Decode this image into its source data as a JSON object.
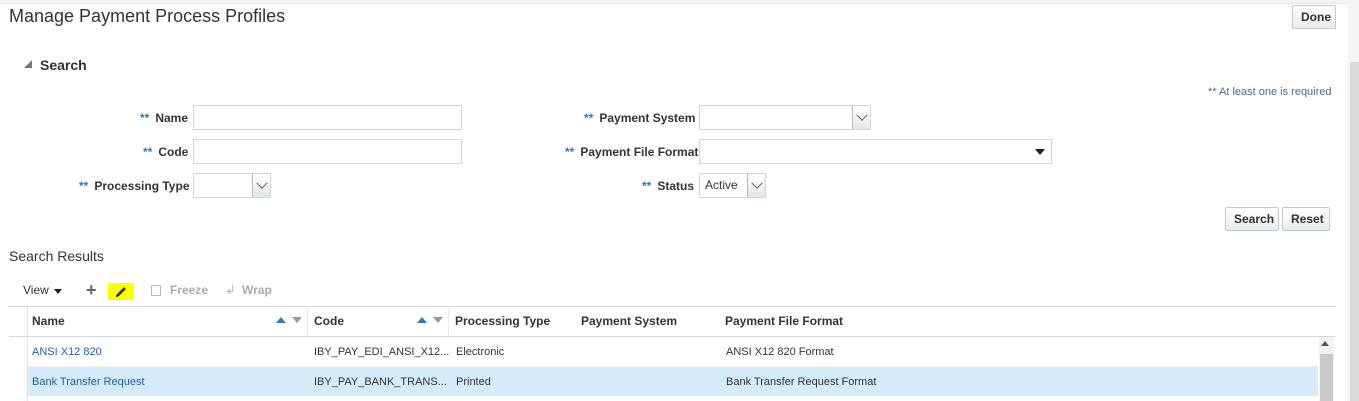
{
  "page": {
    "title": "Manage Payment Process Profiles",
    "done_label": "Done"
  },
  "search": {
    "header": "Search",
    "required_note": "** At least one is required",
    "required_marker": "**",
    "fields": {
      "name": {
        "label": "Name",
        "value": ""
      },
      "code": {
        "label": "Code",
        "value": ""
      },
      "processing_type": {
        "label": "Processing Type",
        "value": ""
      },
      "payment_system": {
        "label": "Payment System",
        "value": ""
      },
      "payment_file_format": {
        "label": "Payment File Format",
        "value": ""
      },
      "status": {
        "label": "Status",
        "value": "Active"
      }
    },
    "search_label": "Search",
    "reset_label": "Reset"
  },
  "results": {
    "title": "Search Results",
    "toolbar": {
      "view": "View",
      "freeze": "Freeze",
      "wrap": "Wrap"
    },
    "columns": [
      "Name",
      "Code",
      "Processing Type",
      "Payment System",
      "Payment File Format"
    ],
    "rows": [
      {
        "name": "ANSI X12 820",
        "code": "IBY_PAY_EDI_ANSI_X12...",
        "processing_type": "Electronic",
        "payment_system": "",
        "payment_file_format": "ANSI X12 820 Format"
      },
      {
        "name": "Bank Transfer Request",
        "code": "IBY_PAY_BANK_TRANS...",
        "processing_type": "Printed",
        "payment_system": "",
        "payment_file_format": "Bank Transfer Request Format"
      }
    ],
    "selected_row": 1
  },
  "colors": {
    "link": "#1f5f9a",
    "selected_row": "#d6ebfa",
    "required_star": "#2d78b4",
    "sort_active": "#2f7bbf",
    "highlight": "#ffff00"
  },
  "icons": [
    "collapse-triangle-icon",
    "view-menu-arrow-icon",
    "plus-icon",
    "pencil-icon",
    "freeze-icon",
    "wrap-icon",
    "sort-ascending-icon",
    "sort-descending-icon",
    "chevron-down-icon",
    "scroll-up-icon"
  ]
}
